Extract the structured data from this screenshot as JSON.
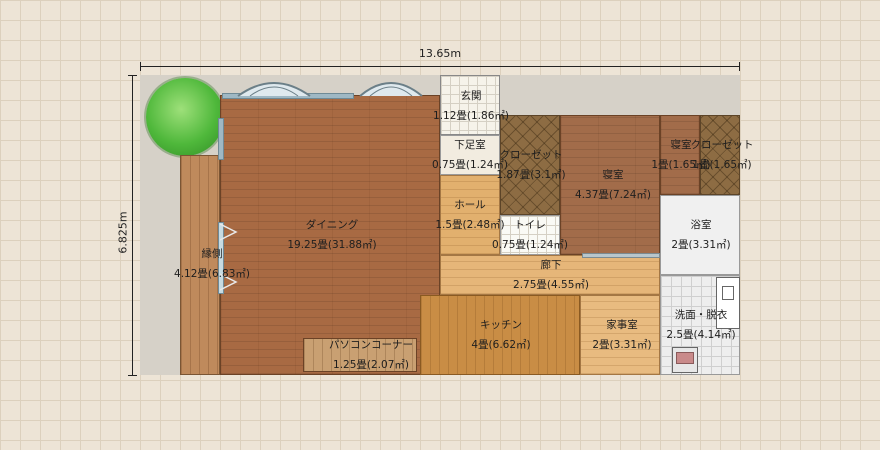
{
  "dimensions": {
    "width_label": "13.65m",
    "height_label": "6.825m"
  },
  "rooms": {
    "genkan": {
      "name": "玄関",
      "area": "1.12畳(1.86㎡)"
    },
    "getashitsu": {
      "name": "下足室",
      "area": "0.75畳(1.24㎡)"
    },
    "closet1": {
      "name": "クローゼット",
      "area": "1.87畳(3.1㎡)"
    },
    "shinshitsu1": {
      "name": "寝室",
      "area": "4.37畳(7.24㎡)"
    },
    "shinshitsu2": {
      "name": "寝室",
      "area": "1畳(1.65㎡)"
    },
    "closet2": {
      "name": "クローゼット",
      "area": "1畳(1.65㎡)"
    },
    "hall": {
      "name": "ホール",
      "area": "1.5畳(2.48㎡)"
    },
    "toilet": {
      "name": "トイレ",
      "area": "0.75畳(1.24㎡)"
    },
    "yokushitsu": {
      "name": "浴室",
      "area": "2畳(3.31㎡)"
    },
    "dining": {
      "name": "ダイニング",
      "area": "19.25畳(31.88㎡)"
    },
    "engawa": {
      "name": "縁側",
      "area": "4.12畳(6.83㎡)"
    },
    "rouka": {
      "name": "廊下",
      "area": "2.75畳(4.55㎡)"
    },
    "kitchen": {
      "name": "キッチン",
      "area": "4畳(6.62㎡)"
    },
    "kajishitsu": {
      "name": "家事室",
      "area": "2畳(3.31㎡)"
    },
    "senmen": {
      "name": "洗面・脱衣",
      "area": "2.5畳(4.14㎡)"
    },
    "pc_corner": {
      "name": "パソコンコーナー",
      "area": "1.25畳(2.07㎡)"
    }
  }
}
